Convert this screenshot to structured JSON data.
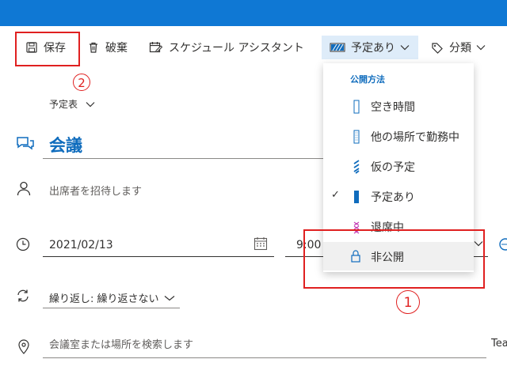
{
  "toolbar": {
    "save_label": "保存",
    "discard_label": "破棄",
    "scheduling_label": "スケジュール アシスタント",
    "showas_label": "予定あり",
    "category_label": "分類"
  },
  "calendar_selector": {
    "label": "予定表"
  },
  "event": {
    "title": "会議",
    "attendees_placeholder": "出席者を招待します",
    "start_date": "2021/02/13",
    "start_time": "9:00",
    "repeat_label": "繰り返し: 繰り返さない",
    "location_placeholder": "会議室または場所を検索します",
    "teams_label": "Tea"
  },
  "showas_menu": {
    "header": "公開方法",
    "items": [
      {
        "label": "空き時間"
      },
      {
        "label": "他の場所で勤務中"
      },
      {
        "label": "仮の予定"
      },
      {
        "label": "予定あり",
        "checked": true
      },
      {
        "label": "退席中"
      },
      {
        "label": "非公開"
      }
    ]
  },
  "annotations": {
    "one": "1",
    "two": "2"
  },
  "colors": {
    "accent": "#0f78d4",
    "highlight": "#e02020",
    "busy": "#0f6cbd",
    "oof": "#c239b3"
  }
}
